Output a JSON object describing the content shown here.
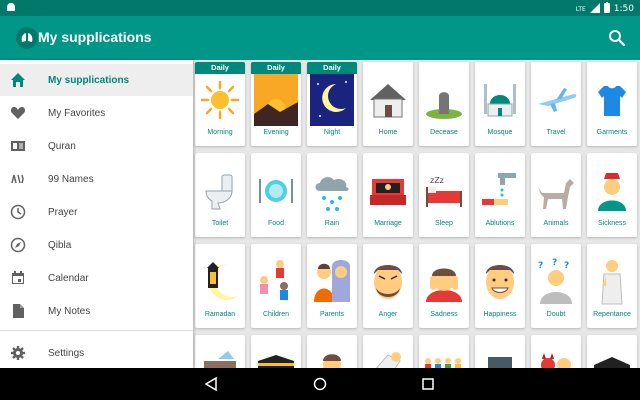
{
  "status": {
    "time": "1:50",
    "network": "LTE"
  },
  "appbar": {
    "title": "My supplications"
  },
  "drawer": {
    "items": [
      {
        "label": "My supplications",
        "icon": "home-icon",
        "active": true
      },
      {
        "label": "My Favorites",
        "icon": "heart-icon"
      },
      {
        "label": "Quran",
        "icon": "book-icon"
      },
      {
        "label": "99 Names",
        "icon": "names-icon"
      },
      {
        "label": "Prayer",
        "icon": "clock-icon"
      },
      {
        "label": "Qibla",
        "icon": "compass-icon"
      },
      {
        "label": "Calendar",
        "icon": "calendar-icon"
      },
      {
        "label": "My Notes",
        "icon": "note-icon"
      }
    ],
    "settings": {
      "label": "Settings",
      "icon": "gear-icon"
    }
  },
  "badge_text": "Daily",
  "categories": [
    {
      "label": "Morning",
      "daily": true,
      "icon": "sun-icon"
    },
    {
      "label": "Evening",
      "daily": true,
      "icon": "sunset-icon"
    },
    {
      "label": "Night",
      "daily": true,
      "icon": "moon-icon"
    },
    {
      "label": "Home",
      "icon": "house-icon"
    },
    {
      "label": "Decease",
      "icon": "grave-icon"
    },
    {
      "label": "Mosque",
      "icon": "mosque-icon"
    },
    {
      "label": "Travel",
      "icon": "airplane-icon"
    },
    {
      "label": "Garments",
      "icon": "shirt-icon"
    },
    {
      "label": "Toilet",
      "icon": "toilet-icon"
    },
    {
      "label": "Food",
      "icon": "plate-icon"
    },
    {
      "label": "Rain",
      "icon": "rain-cloud-icon"
    },
    {
      "label": "Marriage",
      "icon": "bed-icon"
    },
    {
      "label": "Sleep",
      "icon": "sleep-icon"
    },
    {
      "label": "Ablutions",
      "icon": "faucet-icon"
    },
    {
      "label": "Animals",
      "icon": "dog-icon"
    },
    {
      "label": "Sickness",
      "icon": "sick-person-icon"
    },
    {
      "label": "Ramadan",
      "icon": "lantern-icon"
    },
    {
      "label": "Children",
      "icon": "children-icon"
    },
    {
      "label": "Parents",
      "icon": "parents-icon"
    },
    {
      "label": "Anger",
      "icon": "angry-face-icon"
    },
    {
      "label": "Sadness",
      "icon": "sad-face-icon"
    },
    {
      "label": "Happiness",
      "icon": "happy-face-icon"
    },
    {
      "label": "Doubt",
      "icon": "doubt-icon"
    },
    {
      "label": "Repentance",
      "icon": "praying-man-icon"
    },
    {
      "label": "",
      "icon": "treasure-icon"
    },
    {
      "label": "",
      "icon": "kaaba-icon"
    },
    {
      "label": "",
      "icon": "man-icon"
    },
    {
      "label": "",
      "icon": "hand-icon"
    },
    {
      "label": "",
      "icon": "crowd-icon"
    },
    {
      "label": "",
      "icon": "shield-icon"
    },
    {
      "label": "",
      "icon": "devils-icon"
    },
    {
      "label": "",
      "icon": "kaaba-icon"
    }
  ],
  "colors": {
    "primary": "#009688",
    "primary_dark": "#00796b",
    "accent_text": "#00897b"
  }
}
